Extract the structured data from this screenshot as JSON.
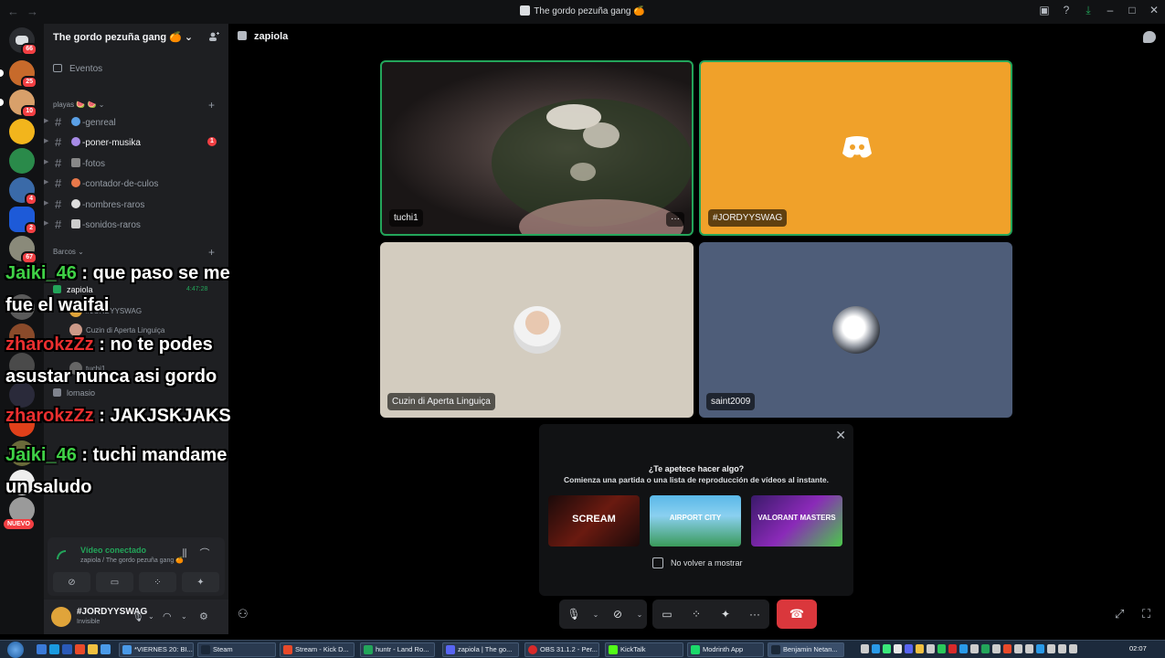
{
  "window": {
    "title": "The gordo pezuña gang 🍊"
  },
  "server_rail": {
    "badges": [
      "66",
      "25",
      "10",
      "",
      "",
      "4",
      "2",
      "67"
    ]
  },
  "sidebar": {
    "guild_name": "The gordo pezuña gang 🍊",
    "events_label": "Eventos",
    "category_1": "playas 🍉 🍉",
    "channels": [
      {
        "name": "-genreal",
        "unread": ""
      },
      {
        "name": "-poner-musika",
        "unread": "1"
      },
      {
        "name": "-fotos",
        "unread": ""
      },
      {
        "name": "-contador-de-culos",
        "unread": ""
      },
      {
        "name": "-nombres-raros",
        "unread": ""
      },
      {
        "name": "-sonidos-raros",
        "unread": ""
      }
    ],
    "category_2": "Barcos",
    "voice_channels": [
      {
        "name": "zapiola",
        "timer": "4:47:28"
      },
      {
        "name": "lomasio",
        "timer": ""
      }
    ],
    "voice_users": [
      "#JORDYYSWAG",
      "Cuzin di Aperta Linguiça",
      "tuchi1"
    ],
    "new_badge": "NUEVO"
  },
  "voice_status": {
    "status": "Vídeo conectado",
    "location": "zapiola / The gordo pezuña gang 🍊"
  },
  "user_panel": {
    "username": "#JORDYYSWAG",
    "status": "Invisible"
  },
  "stream_chat": [
    {
      "user": "Jaiki_46",
      "user_color": "#3fd146",
      "text": ": que paso se me",
      "cont": "fue el waifai"
    },
    {
      "user": "zharokzZz",
      "user_color": "#ea2f2f",
      "text": ": no te podes",
      "cont": "asustar nunca asi gordo"
    },
    {
      "user": "zharokzZz",
      "user_color": "#ea2f2f",
      "text": ": JAKJSKJAKS",
      "cont": ""
    },
    {
      "user": "Jaiki_46",
      "user_color": "#3fd146",
      "text": ": tuchi mandame",
      "cont": "un saludo"
    }
  ],
  "call": {
    "channel_name": "zapiola",
    "tiles": [
      {
        "name": "tuchi1",
        "more": "···"
      },
      {
        "name": "#JORDYYSWAG",
        "bg": "#f0a12a"
      },
      {
        "name": "Cuzin di Aperta Linguiça",
        "bg": "#d3ccbf"
      },
      {
        "name": "saint2009",
        "bg": "#4e5d79"
      }
    ]
  },
  "activity_popup": {
    "question": "¿Te apetece hacer algo?",
    "description": "Comienza una partida o una lista de reproducción de vídeos al instante.",
    "games": [
      "SCREAM",
      "AIRPORT CITY",
      "VALORANT MASTERS"
    ],
    "dont_show_label": "No volver a mostrar"
  },
  "taskbar": {
    "apps": [
      "*VIERNES 20: BI...",
      "Steam",
      "Stream - Kick D...",
      "huntr - Land Ro...",
      "zapiola | The go...",
      "OBS 31.1.2 - Per...",
      "KickTalk",
      "Modrinth App",
      "Benjamin Netan..."
    ],
    "clock": "02:07"
  }
}
